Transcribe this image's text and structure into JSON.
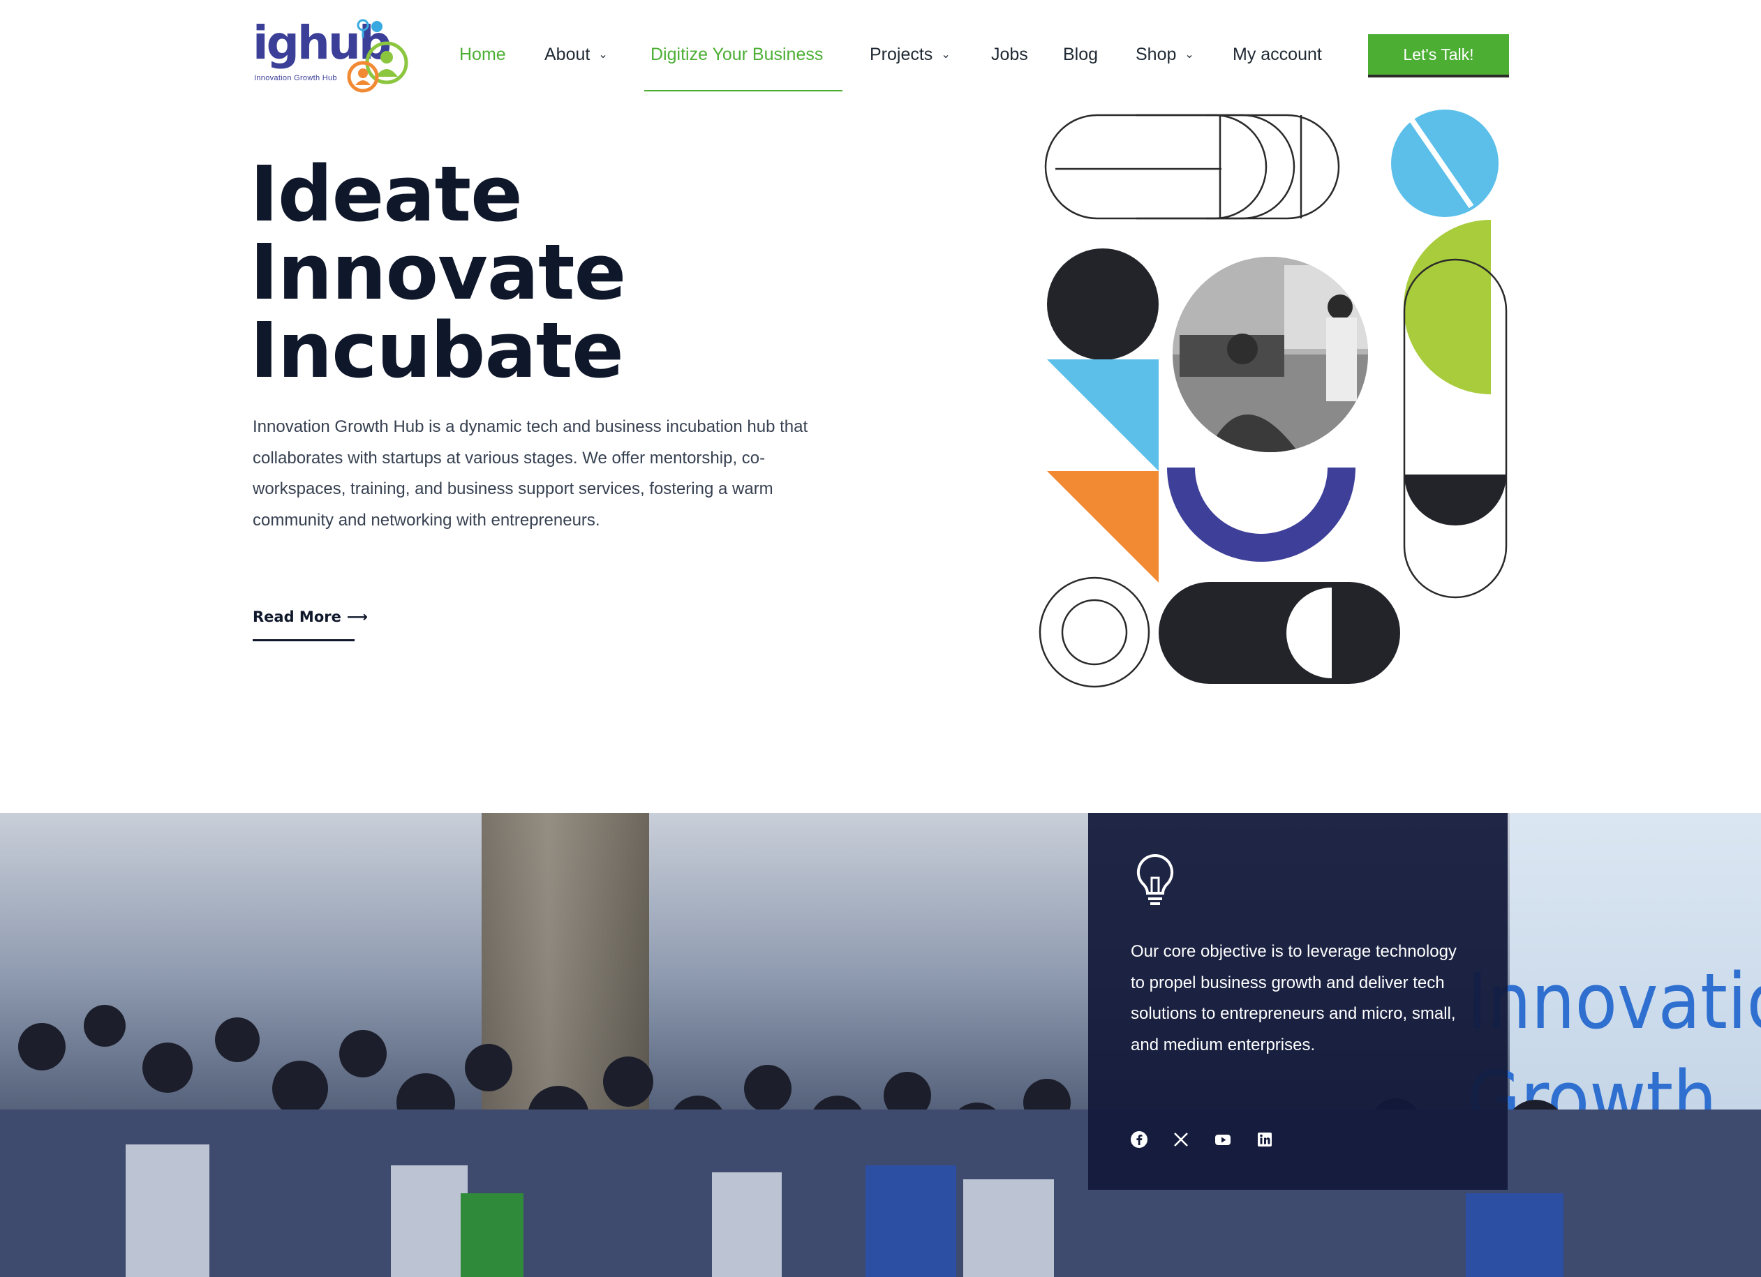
{
  "brand": {
    "logo_text": "ighub",
    "logo_tagline": "Innovation Growth Hub"
  },
  "nav": {
    "items": [
      {
        "label": "Home",
        "active": true
      },
      {
        "label": "About",
        "has_dropdown": true
      },
      {
        "label": "Digitize Your Business",
        "active": true
      },
      {
        "label": "Projects",
        "has_dropdown": true
      },
      {
        "label": "Jobs"
      },
      {
        "label": "Blog"
      },
      {
        "label": "Shop",
        "has_dropdown": true
      },
      {
        "label": "My account"
      }
    ],
    "cta_label": "Let's Talk!"
  },
  "hero": {
    "title_lines": [
      "Ideate",
      "Innovate",
      "Incubate"
    ],
    "description": "Innovation Growth Hub is a dynamic tech and business incubation hub that collaborates with startups at various stages. We offer mentorship, co-workspaces, training, and business support services, fostering a warm community and networking with entrepreneurs.",
    "read_more_label": "Read More"
  },
  "objective": {
    "text": "Our core objective is to leverage technology to propel business growth and deliver tech solutions to entrepreneurs and micro, small, and medium enterprises."
  },
  "social": [
    "facebook-icon",
    "x-twitter-icon",
    "youtube-icon",
    "linkedin-icon"
  ],
  "background_photo": {
    "wall_text": "Innovatio\nGrowth"
  },
  "colors": {
    "accent_green": "#4caf34",
    "navy": "#0f172a",
    "panel": "#111838",
    "shape_blue": "#5bbfea",
    "shape_lime": "#a8cc3c",
    "shape_orange": "#f28a34",
    "shape_indigo": "#3d3f98",
    "shape_dark": "#232429"
  }
}
